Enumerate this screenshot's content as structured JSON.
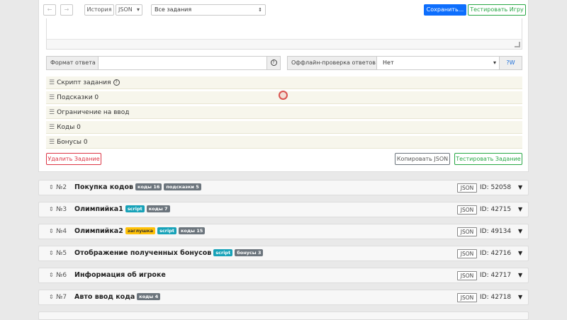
{
  "toolbar": {
    "back_arrow": "←",
    "forward_arrow": "→",
    "history": "История",
    "json": "JSON",
    "json_caret": "▾",
    "task_select": "Все задания",
    "task_select_arrows": "⇕",
    "save": "Сохранить...",
    "test_game": "Тестировать Игру"
  },
  "answer_format": {
    "label": "Формат ответа",
    "value": "",
    "help": "?"
  },
  "offline_check": {
    "label": "Оффлайн-проверка ответов",
    "value": "Нет",
    "caret": "▾",
    "addon": "?W"
  },
  "sections": [
    {
      "label": "Скрипт задания",
      "help": "?"
    },
    {
      "label": "Подсказки 0"
    },
    {
      "label": "Ограничение на ввод"
    },
    {
      "label": "Коды 0"
    },
    {
      "label": "Бонусы 0"
    }
  ],
  "buttons": {
    "delete_task": "Удалить Задание",
    "copy_json": "Копировать JSON",
    "test_task": "Тестировать Задание"
  },
  "tasks": [
    {
      "num": "№2",
      "title": "Покупка кодов",
      "badges": [
        {
          "text": "коды 16",
          "color": "grey"
        },
        {
          "text": "подсказки 5",
          "color": "grey"
        }
      ],
      "json": "JSON",
      "id": "ID: 52058",
      "caret": "▼"
    },
    {
      "num": "№3",
      "title": "Олимпийка1",
      "badges": [
        {
          "text": "script",
          "color": "teal"
        },
        {
          "text": "коды 7",
          "color": "grey"
        }
      ],
      "json": "JSON",
      "id": "ID: 42715",
      "caret": "▼"
    },
    {
      "num": "№4",
      "title": "Олимпийка2",
      "badges": [
        {
          "text": "заглушка",
          "color": "yellow"
        },
        {
          "text": "script",
          "color": "teal"
        },
        {
          "text": "коды 15",
          "color": "grey"
        }
      ],
      "json": "JSON",
      "id": "ID: 49134",
      "caret": "▼"
    },
    {
      "num": "№5",
      "title": "Отображение полученных бонусов",
      "badges": [
        {
          "text": "script",
          "color": "teal"
        },
        {
          "text": "бонусы 3",
          "color": "grey"
        }
      ],
      "json": "JSON",
      "id": "ID: 42716",
      "caret": "▼"
    },
    {
      "num": "№6",
      "title": "Информация об игроке",
      "badges": [],
      "json": "JSON",
      "id": "ID: 42717",
      "caret": "▼"
    },
    {
      "num": "№7",
      "title": "Авто ввод кода",
      "badges": [
        {
          "text": "коды 4",
          "color": "grey"
        }
      ],
      "json": "JSON",
      "id": "ID: 42718",
      "caret": "▼"
    }
  ],
  "task_handle": "⇕",
  "section_handle": "☰"
}
